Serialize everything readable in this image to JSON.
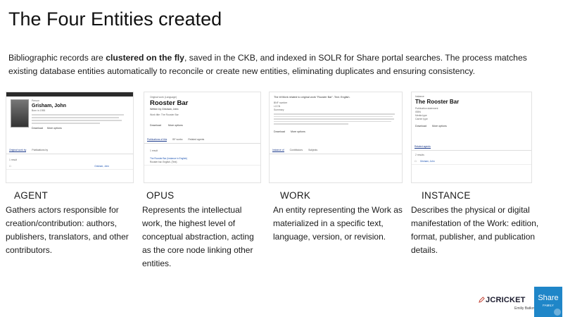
{
  "title": "The Four Entities created",
  "intro": {
    "part1": "Bibliographic records are ",
    "bold": "clustered on the fly",
    "part2": ", saved in the CKB, and indexed in SOLR for Share portal searches. The process matches existing database entities automatically to reconcile or create new entities, eliminating duplicates and ensuring consistency."
  },
  "entities": [
    {
      "label": "AGENT",
      "description": "Gathers actors responsible for creation/contribution: authors, publishers, translators, and other contributors.",
      "screenshot": {
        "kicker": "Person",
        "heading": "Grisham, John",
        "meta": "Born in 1955",
        "buttons": [
          "Download",
          "More options"
        ],
        "tabs": [
          "Original work by",
          "Publications by"
        ],
        "result_count": "1 result",
        "row": "Grisham, John"
      }
    },
    {
      "label": "OPUS",
      "description": "Represents the intellectual work, the highest level of conceptual abstraction, acting as the core node linking other entities.",
      "screenshot": {
        "kicker": "Original work (Language)",
        "heading": "Rooster Bar",
        "byline": "Written by Grisham, John",
        "meta": "Work title: The Rooster Bar",
        "buttons": [
          "Download",
          "More options"
        ],
        "tabs": [
          "Publications of this",
          "BF works",
          "Related agents"
        ],
        "result_count": "1 result",
        "row": "The Rooster Bar (Instance in English)",
        "row_sub": "Rooster bar. English. (Text)"
      }
    },
    {
      "label": "WORK",
      "description": "An entity representing the Work as materialized in a specific text, language, version, or revision.",
      "screenshot": {
        "heading": "The bf:Work related to original work \"Rooster Bar\". Text. English.",
        "fields": [
          "BNF number",
          "LCCN",
          "Summary"
        ],
        "buttons": [
          "Download",
          "More options"
        ],
        "tabs": [
          "Instance of",
          "Contributors",
          "Subjects"
        ]
      }
    },
    {
      "label": "INSTANCE",
      "description": "Describes the physical or digital manifestation of the Work: edition, format, publisher, and publication details.",
      "screenshot": {
        "kicker": "Instance",
        "heading": "The Rooster Bar",
        "fields": [
          "Publication statement",
          "ISBN",
          "Media type",
          "Carrier type"
        ],
        "buttons": [
          "Download",
          "More options"
        ],
        "section": "Related agents",
        "result_count": "2 results",
        "row": "Grisham, John"
      }
    }
  ],
  "brand": {
    "name": "JCRICKET",
    "subtitle": "Emiliy Batkov",
    "logo_text": "Share",
    "logo_sub": "FAMILY",
    "logo_color": "#1f86c8"
  }
}
